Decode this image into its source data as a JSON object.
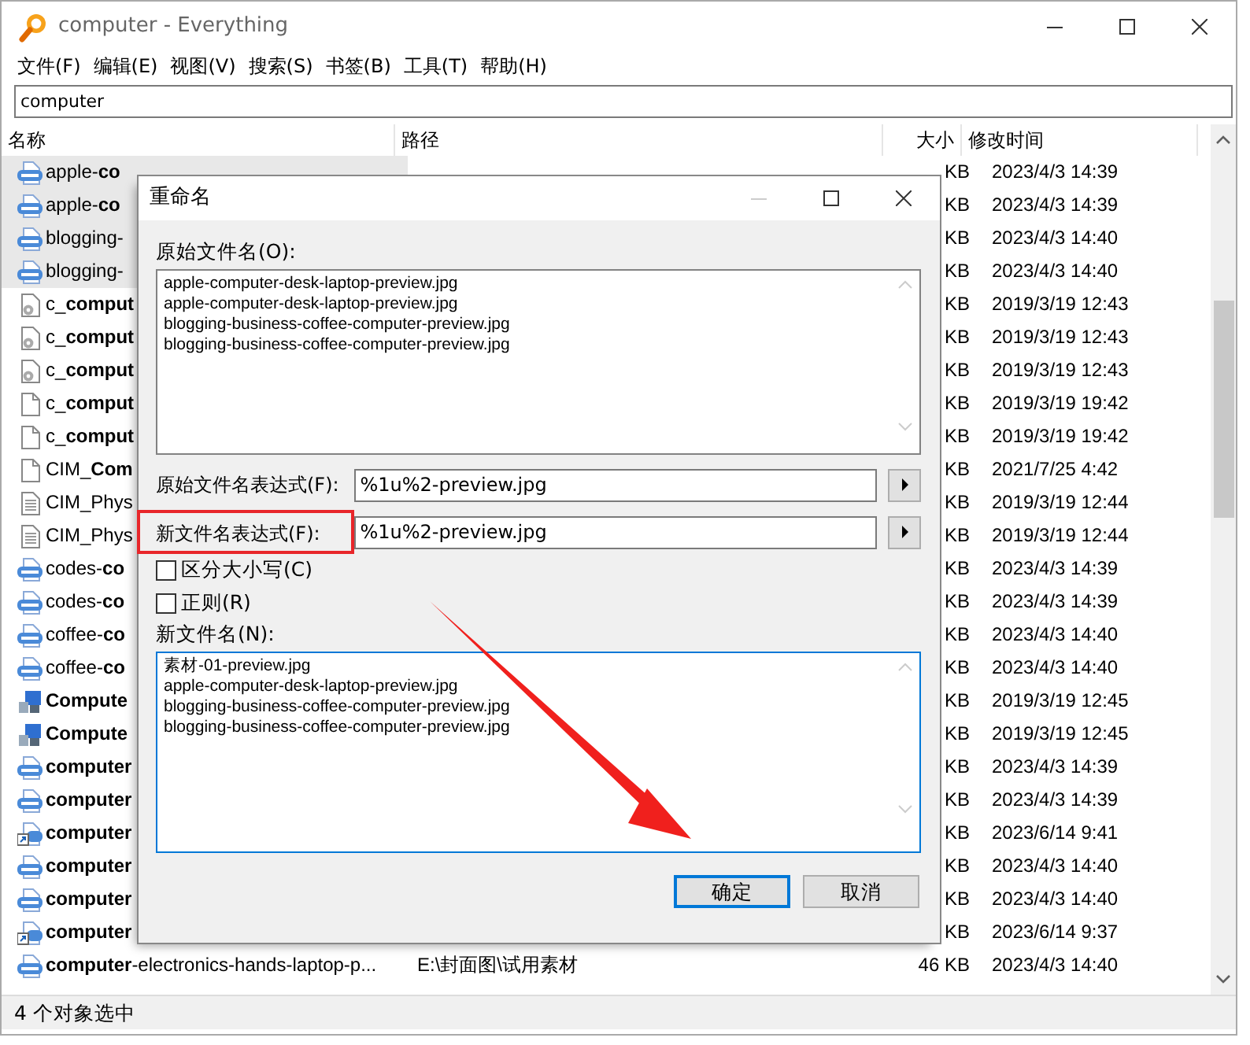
{
  "window": {
    "title": "computer - Everything"
  },
  "menu": [
    "文件(F)",
    "编辑(E)",
    "视图(V)",
    "搜索(S)",
    "书签(B)",
    "工具(T)",
    "帮助(H)"
  ],
  "search": {
    "value": "computer"
  },
  "table": {
    "columns": [
      "名称",
      "路径",
      "大小",
      "修改时间"
    ],
    "rows": [
      {
        "kind": "jpg",
        "name": "apple-**co**",
        "size": "KB",
        "modified": "2023/4/3 14:39",
        "selected": true
      },
      {
        "kind": "jpg",
        "name": "apple-**co**",
        "size": "KB",
        "modified": "2023/4/3 14:39",
        "selected": true
      },
      {
        "kind": "jpg",
        "name": "blogging-",
        "size": "KB",
        "modified": "2023/4/3 14:40",
        "selected": true
      },
      {
        "kind": "jpg",
        "name": "blogging-",
        "size": "KB",
        "modified": "2023/4/3 14:40",
        "selected": true
      },
      {
        "kind": "gear",
        "name": "c_**comput**",
        "size": "KB",
        "modified": "2019/3/19 12:43",
        "selected": false
      },
      {
        "kind": "gear",
        "name": "c_**comput**",
        "size": "KB",
        "modified": "2019/3/19 12:43",
        "selected": false
      },
      {
        "kind": "gear",
        "name": "c_**comput**",
        "size": "KB",
        "modified": "2019/3/19 12:43",
        "selected": false
      },
      {
        "kind": "file",
        "name": "c_**comput**",
        "size": "KB",
        "modified": "2019/3/19 19:42",
        "selected": false
      },
      {
        "kind": "file",
        "name": "c_**comput**",
        "size": "KB",
        "modified": "2019/3/19 19:42",
        "selected": false
      },
      {
        "kind": "file",
        "name": "CIM_**Com**",
        "size": "KB",
        "modified": "2021/7/25 4:42",
        "selected": false
      },
      {
        "kind": "text",
        "name": "CIM_Phys",
        "size": "KB",
        "modified": "2019/3/19 12:44",
        "selected": false
      },
      {
        "kind": "text",
        "name": "CIM_Phys",
        "size": "KB",
        "modified": "2019/3/19 12:44",
        "selected": false
      },
      {
        "kind": "jpg",
        "name": "codes-**co**",
        "size": "KB",
        "modified": "2023/4/3 14:39",
        "selected": false
      },
      {
        "kind": "jpg",
        "name": "codes-**co**",
        "size": "KB",
        "modified": "2023/4/3 14:39",
        "selected": false
      },
      {
        "kind": "jpg",
        "name": "coffee-**co**",
        "size": "KB",
        "modified": "2023/4/3 14:40",
        "selected": false
      },
      {
        "kind": "jpg",
        "name": "coffee-**co**",
        "size": "KB",
        "modified": "2023/4/3 14:40",
        "selected": false
      },
      {
        "kind": "app",
        "name": "**Compute**",
        "size": "KB",
        "modified": "2019/3/19 12:45",
        "selected": false
      },
      {
        "kind": "app",
        "name": "**Compute**",
        "size": "KB",
        "modified": "2019/3/19 12:45",
        "selected": false
      },
      {
        "kind": "jpg",
        "name": "**computer**",
        "size": "KB",
        "modified": "2023/4/3 14:39",
        "selected": false
      },
      {
        "kind": "jpg",
        "name": "**computer**",
        "size": "KB",
        "modified": "2023/4/3 14:39",
        "selected": false
      },
      {
        "kind": "shortcut",
        "name": "**computer**",
        "size": "KB",
        "modified": "2023/6/14 9:41",
        "selected": false
      },
      {
        "kind": "jpg",
        "name": "**computer**",
        "size": "KB",
        "modified": "2023/4/3 14:40",
        "selected": false
      },
      {
        "kind": "jpg",
        "name": "**computer**",
        "size": "KB",
        "modified": "2023/4/3 14:40",
        "selected": false
      },
      {
        "kind": "shortcut",
        "name": "**computer**",
        "size": "KB",
        "modified": "2023/6/14 9:37",
        "selected": false
      },
      {
        "kind": "jpg",
        "name": "**computer**-electronics-hands-laptop-p...",
        "path": "E:\\封面图\\试用素材",
        "size": "46 KB",
        "modified": "2023/4/3 14:40",
        "selected": false
      }
    ]
  },
  "status_bar": "4 个对象选中",
  "dialog": {
    "title": "重命名",
    "original_label": "原始文件名(O):",
    "original_names": [
      "apple-computer-desk-laptop-preview.jpg",
      "apple-computer-desk-laptop-preview.jpg",
      "blogging-business-coffee-computer-preview.jpg",
      "blogging-business-coffee-computer-preview.jpg"
    ],
    "expressions": [
      {
        "label": "原始文件名表达式(F):",
        "value": "%1u%2-preview.jpg",
        "highlighted": false
      },
      {
        "label": "新文件名表达式(F):",
        "value": "%1u%2-preview.jpg",
        "highlighted": true
      }
    ],
    "checkboxes": [
      {
        "label": "区分大小写(C)",
        "checked": false
      },
      {
        "label": "正则(R)",
        "checked": false
      }
    ],
    "new_label": "新文件名(N):",
    "new_names": [
      "素材-01-preview.jpg",
      "apple-computer-desk-laptop-preview.jpg",
      "blogging-business-coffee-computer-preview.jpg",
      "blogging-business-coffee-computer-preview.jpg"
    ],
    "buttons": [
      {
        "label": "确定",
        "default": true
      },
      {
        "label": "取消",
        "default": false
      }
    ]
  }
}
